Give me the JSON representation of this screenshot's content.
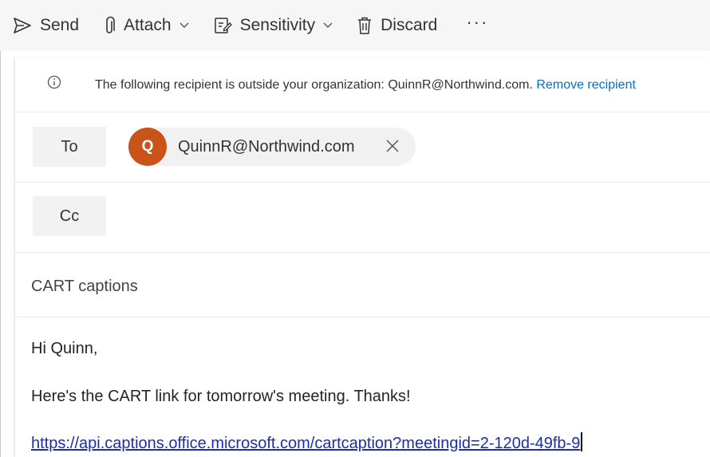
{
  "toolbar": {
    "send_label": "Send",
    "attach_label": "Attach",
    "sensitivity_label": "Sensitivity",
    "discard_label": "Discard",
    "more_label": "···"
  },
  "infobar": {
    "message": "The following recipient is outside your organization: QuinnR@Northwind.com.",
    "action_label": "Remove recipient"
  },
  "to": {
    "label": "To",
    "recipient": {
      "initial": "Q",
      "email": "QuinnR@Northwind.com",
      "avatar_color": "#c85419"
    }
  },
  "cc": {
    "label": "Cc"
  },
  "subject": {
    "value": "CART captions"
  },
  "body": {
    "greeting": "Hi Quinn,",
    "line": "Here's the CART link for tomorrow's meeting. Thanks!",
    "link": "https://api.captions.office.microsoft.com/cartcaption?meetingid=2-120d-49fb-9"
  },
  "icons": {
    "send": "send-icon",
    "attach": "paperclip-icon",
    "sensitivity": "sensitivity-icon",
    "discard": "trash-icon",
    "info": "info-icon",
    "remove": "close-icon"
  }
}
